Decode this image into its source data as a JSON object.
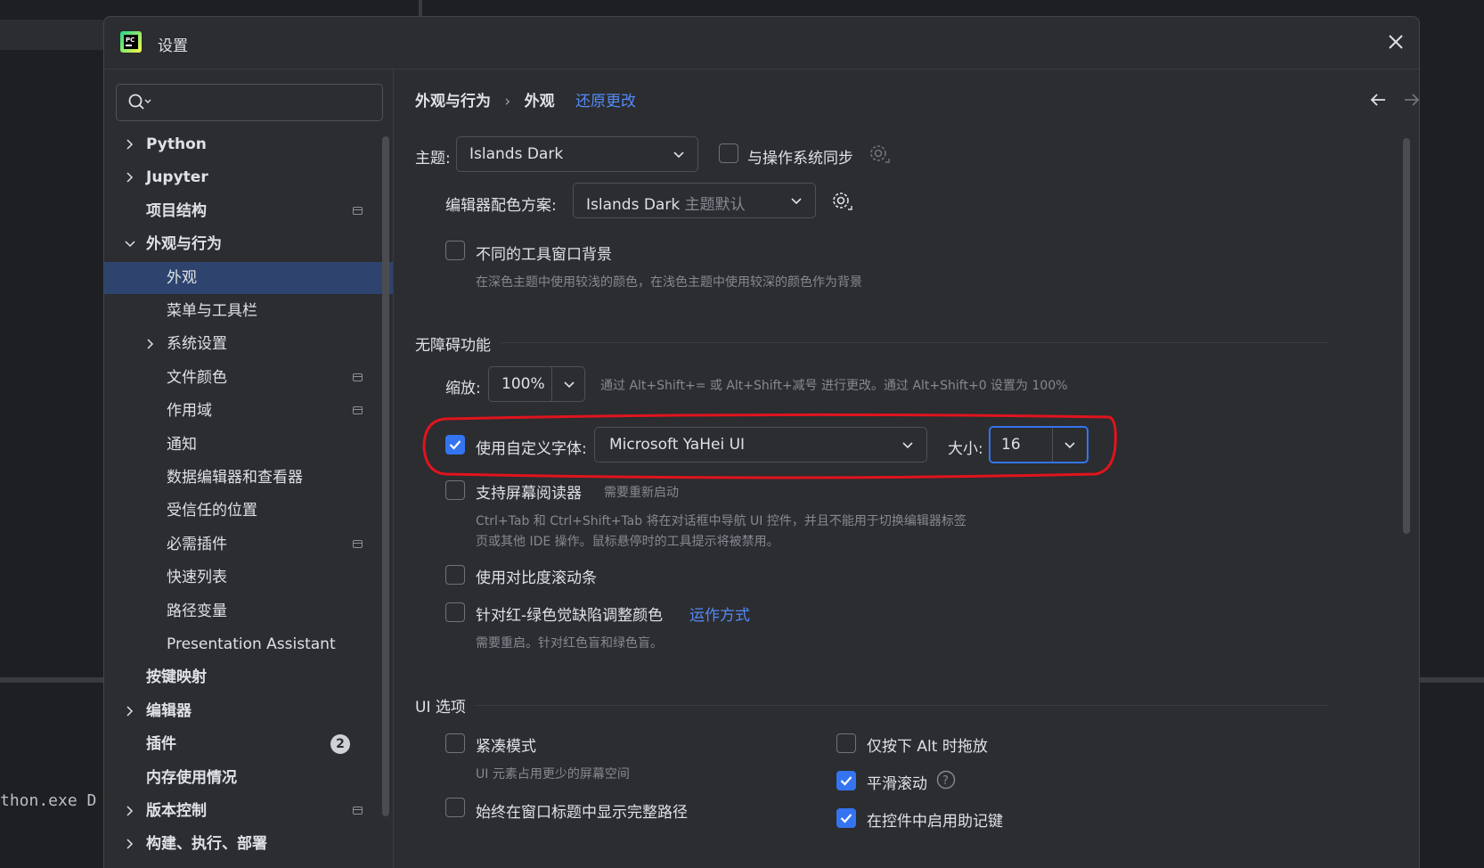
{
  "background": {
    "terminal_text": "thon.exe D"
  },
  "dialog": {
    "title": "设置",
    "accent": "#3574f0",
    "selection_color": "#2e436e",
    "highlight_color": "#e0141e"
  },
  "sidebar": {
    "search_placeholder": "",
    "items": [
      {
        "label": "Python",
        "bold": true,
        "chevron": "right"
      },
      {
        "label": "Jupyter",
        "bold": true,
        "chevron": "right"
      },
      {
        "label": "项目结构",
        "bold": true
      },
      {
        "label": "外观与行为",
        "bold": true,
        "chevron": "down"
      },
      {
        "label": "外观",
        "selected": true
      },
      {
        "label": "菜单与工具栏"
      },
      {
        "label": "系统设置",
        "chevron": "right"
      },
      {
        "label": "文件颜色"
      },
      {
        "label": "作用域"
      },
      {
        "label": "通知"
      },
      {
        "label": "数据编辑器和查看器"
      },
      {
        "label": "受信任的位置"
      },
      {
        "label": "必需插件"
      },
      {
        "label": "快速列表"
      },
      {
        "label": "路径变量"
      },
      {
        "label": "Presentation Assistant"
      },
      {
        "label": "按键映射",
        "bold": true
      },
      {
        "label": "编辑器",
        "bold": true,
        "chevron": "right"
      },
      {
        "label": "插件",
        "bold": true,
        "badge": "2"
      },
      {
        "label": "内存使用情况",
        "bold": true
      },
      {
        "label": "版本控制",
        "bold": true,
        "chevron": "right"
      },
      {
        "label": "构建、执行、部署",
        "bold": true,
        "chevron": "right"
      }
    ]
  },
  "breadcrumb": {
    "parent": "外观与行为",
    "separator": "›",
    "current": "外观",
    "reset_link": "还原更改"
  },
  "theme": {
    "label": "主题:",
    "value": "Islands Dark",
    "sync_label": "与操作系统同步",
    "sync_checked": false
  },
  "editor_scheme": {
    "label": "编辑器配色方案:",
    "value": "Islands Dark",
    "hint": "主题默认"
  },
  "tool_window_bg": {
    "label": "不同的工具窗口背景",
    "checked": false,
    "description": "在深色主题中使用较浅的颜色，在浅色主题中使用较深的颜色作为背景"
  },
  "accessibility": {
    "section_title": "无障碍功能",
    "zoom_label": "缩放:",
    "zoom_value": "100%",
    "zoom_hint": "通过 Alt+Shift+= 或 Alt+Shift+减号 进行更改。通过 Alt+Shift+0 设置为 100%",
    "custom_font_label": "使用自定义字体:",
    "custom_font_checked": true,
    "font_value": "Microsoft YaHei UI",
    "size_label": "大小:",
    "size_value": "16",
    "screen_reader_label": "支持屏幕阅读器",
    "screen_reader_hint": "需要重新启动",
    "screen_reader_checked": false,
    "screen_reader_desc_1": "Ctrl+Tab 和 Ctrl+Shift+Tab 将在对话框中导航 UI 控件，并且不能用于切换编辑器标签",
    "screen_reader_desc_2": "页或其他 IDE 操作。鼠标悬停时的工具提示将被禁用。",
    "contrast_scrollbar_label": "使用对比度滚动条",
    "contrast_scrollbar_checked": false,
    "color_blind_label": "针对红-绿色觉缺陷调整颜色",
    "color_blind_link": "运作方式",
    "color_blind_checked": false,
    "color_blind_desc": "需要重启。针对红色盲和绿色盲。"
  },
  "ui_options": {
    "section_title": "UI 选项",
    "compact_label": "紧凑模式",
    "compact_checked": false,
    "compact_desc": "UI 元素占用更少的屏幕空间",
    "full_path_label": "始终在窗口标题中显示完整路径",
    "full_path_checked": false,
    "alt_drag_label": "仅按下 Alt 时拖放",
    "alt_drag_checked": false,
    "smooth_scroll_label": "平滑滚动",
    "smooth_scroll_checked": true,
    "mnemonics_label": "在控件中启用助记键",
    "mnemonics_checked": true
  }
}
